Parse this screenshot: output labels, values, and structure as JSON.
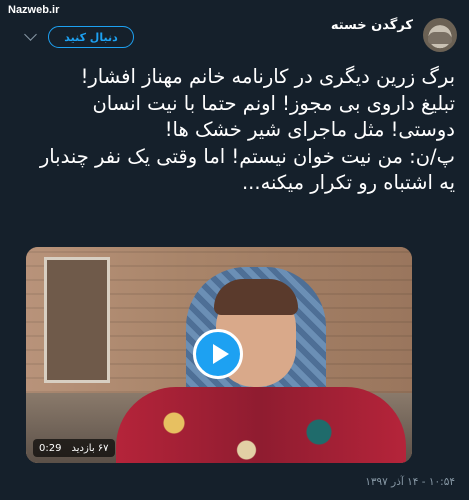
{
  "watermark": "Nazweb.ir",
  "tweet": {
    "username": "کرگدن خسته",
    "handle": "",
    "follow_label": "دنبال کنید",
    "text_lines": [
      "برگ زرین دیگری در کارنامه خانم مهناز افشار!",
      "تبلیغ داروی بی مجوز! اونم حتما با نیت انسان دوستی! مثل ماجرای شیر خشک ها!",
      "پ/ن: من نیت خوان نیستم! اما وقتی یک نفر چندبار یه اشتباه رو تکرار میکنه..."
    ],
    "video": {
      "duration": "0:29",
      "views": "۶۷ بازدید"
    },
    "timestamp": "۱۰:۵۴ - ۱۴ آذر ۱۳۹۷"
  },
  "icons": {
    "avatar": "rhino-avatar",
    "menu": "chevron-down-icon",
    "play": "play-icon"
  },
  "colors": {
    "background": "#15202b",
    "accent": "#1da1f2",
    "secondary_text": "#8899a6"
  }
}
